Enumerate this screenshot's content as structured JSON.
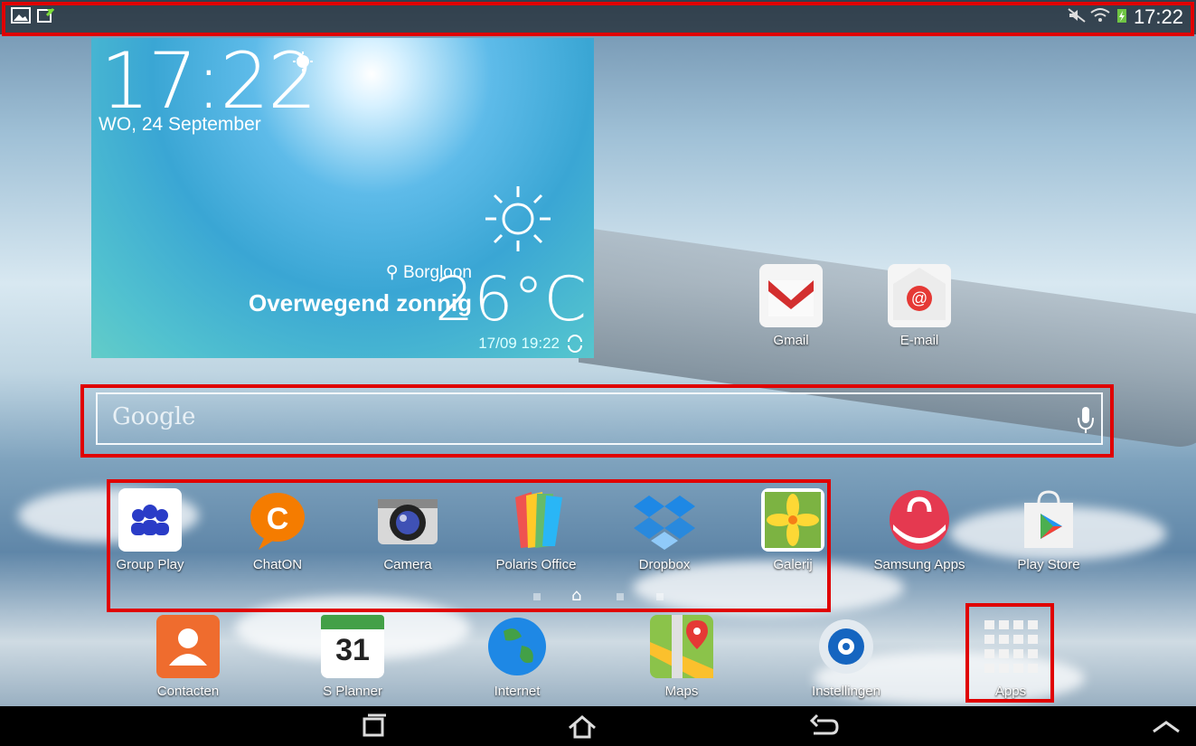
{
  "status_bar": {
    "left_icons": [
      "gallery-icon",
      "usb-icon"
    ],
    "right_icons": [
      "mute-icon",
      "wifi-icon",
      "battery-charging-icon"
    ],
    "time": "17:22"
  },
  "widget": {
    "time": "17:22",
    "date": "WO, 24 September",
    "location": "Borgloon",
    "condition": "Overwegend zonnig",
    "temperature": "26°C",
    "updated": "17/09 19:22"
  },
  "desktop_icons": [
    {
      "label": "Gmail"
    },
    {
      "label": "E-mail"
    }
  ],
  "search": {
    "placeholder": "Google"
  },
  "apps_row": [
    {
      "label": "Group Play"
    },
    {
      "label": "ChatON"
    },
    {
      "label": "Camera"
    },
    {
      "label": "Polaris Office"
    },
    {
      "label": "Dropbox"
    },
    {
      "label": "Galerij"
    },
    {
      "label": "Samsung Apps"
    },
    {
      "label": "Play Store"
    }
  ],
  "page_indicator": {
    "current": "home-icon"
  },
  "dock": [
    {
      "label": "Contacten"
    },
    {
      "label": "S Planner",
      "calendar_day": "31"
    },
    {
      "label": "Internet"
    },
    {
      "label": "Maps"
    },
    {
      "label": "Instellingen"
    },
    {
      "label": "Apps"
    }
  ],
  "colors": {
    "highlight": "#e00000",
    "navbar": "#000000"
  }
}
